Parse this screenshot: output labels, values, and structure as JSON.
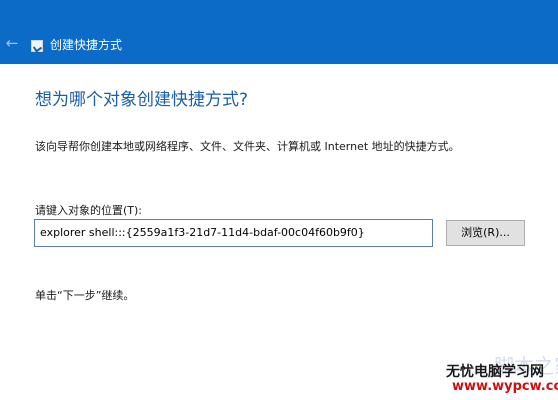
{
  "window": {
    "title": "创建快捷方式",
    "back_icon": "arrow-left-icon",
    "app_icon": "shortcut-icon"
  },
  "wizard": {
    "heading": "想为哪个对象创建快捷方式?",
    "description": "该向导帮你创建本地或网络程序、文件、文件夹、计算机或 Internet 地址的快捷方式。",
    "location_label": "请键入对象的位置(T):",
    "location_value": "explorer shell:::{2559a1f3-21d7-11d4-bdaf-00c04f60b9f0}",
    "browse_label": "浏览(R)...",
    "next_hint": "单击“下一步”继续。"
  },
  "watermark": {
    "line1": "无忧电脑学习网",
    "line2": "www.wypcw.com",
    "background_text": "脚本之家"
  },
  "colors": {
    "titlebar": "#0b6bc6",
    "heading": "#1a5fa6",
    "watermark_url": "#cc1010"
  }
}
